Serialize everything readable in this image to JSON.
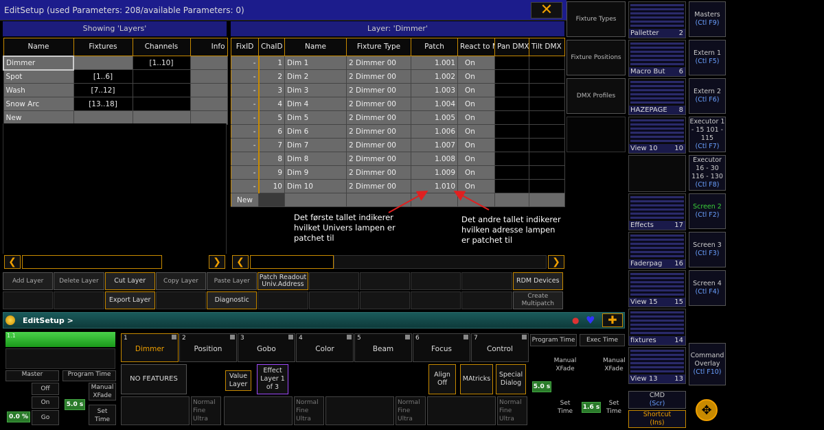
{
  "title": "EditSetup   (used Parameters: 208/available Parameters: 0)",
  "close_icon": "close-x",
  "left_panel": {
    "header": "Showing 'Layers'",
    "columns": [
      "Name",
      "Fixtures",
      "Channels",
      "Info"
    ],
    "rows": [
      {
        "name": "Dimmer",
        "fixtures": "",
        "channels": "[1..10]"
      },
      {
        "name": "Spot",
        "fixtures": "[1..6]",
        "channels": ""
      },
      {
        "name": "Wash",
        "fixtures": "[7..12]",
        "channels": ""
      },
      {
        "name": "Snow Arc",
        "fixtures": "[13..18]",
        "channels": ""
      },
      {
        "name": "New",
        "fixtures": "",
        "channels": ""
      }
    ]
  },
  "right_panel": {
    "header": "Layer: 'Dimmer'",
    "columns": [
      "FixID",
      "ChaID",
      "Name",
      "Fixture Type",
      "Patch",
      "React to Master",
      "Pan DMX Invert",
      "Tilt DMX Invert"
    ],
    "rows": [
      {
        "fixid": "-",
        "chaid": "1",
        "name": "Dim 1",
        "type": "2 Dimmer 00",
        "patch": "1.001",
        "react": "On"
      },
      {
        "fixid": "-",
        "chaid": "2",
        "name": "Dim 2",
        "type": "2 Dimmer 00",
        "patch": "1.002",
        "react": "On"
      },
      {
        "fixid": "-",
        "chaid": "3",
        "name": "Dim 3",
        "type": "2 Dimmer 00",
        "patch": "1.003",
        "react": "On"
      },
      {
        "fixid": "-",
        "chaid": "4",
        "name": "Dim 4",
        "type": "2 Dimmer 00",
        "patch": "1.004",
        "react": "On"
      },
      {
        "fixid": "-",
        "chaid": "5",
        "name": "Dim 5",
        "type": "2 Dimmer 00",
        "patch": "1.005",
        "react": "On"
      },
      {
        "fixid": "-",
        "chaid": "6",
        "name": "Dim 6",
        "type": "2 Dimmer 00",
        "patch": "1.006",
        "react": "On"
      },
      {
        "fixid": "-",
        "chaid": "7",
        "name": "Dim 7",
        "type": "2 Dimmer 00",
        "patch": "1.007",
        "react": "On"
      },
      {
        "fixid": "-",
        "chaid": "8",
        "name": "Dim 8",
        "type": "2 Dimmer 00",
        "patch": "1.008",
        "react": "On"
      },
      {
        "fixid": "-",
        "chaid": "9",
        "name": "Dim 9",
        "type": "2 Dimmer 00",
        "patch": "1.009",
        "react": "On"
      },
      {
        "fixid": "-",
        "chaid": "10",
        "name": "Dim 10",
        "type": "2 Dimmer 00",
        "patch": "1.010",
        "react": "On"
      }
    ],
    "new_label": "New"
  },
  "annotations": {
    "left": "Det første tallet indikerer hvilket Univers lampen er patchet til",
    "right": "Det andre tallet indikerer hvilken adresse lampen er patchet til"
  },
  "buttons_row1": [
    "Add Layer",
    "Delete Layer",
    "Cut Layer",
    "Copy Layer",
    "Paste Layer",
    "Patch Readout Univ.Address",
    "",
    "",
    "",
    "",
    "RDM Devices"
  ],
  "buttons_row2": [
    "",
    "",
    "Export Layer",
    "",
    "Diagnostic",
    "",
    "",
    "",
    "",
    "",
    "Create Multipatch"
  ],
  "side_buttons": [
    "Fixture Types",
    "Fixture Positions",
    "DMX Profiles"
  ],
  "views": [
    {
      "label": "Palletter",
      "num": "2"
    },
    {
      "label": "Macro But",
      "num": "6"
    },
    {
      "label": "HAZEPAGE",
      "num": "8"
    },
    {
      "label": "View 10",
      "num": "10"
    },
    {
      "label": "",
      "num": ""
    },
    {
      "label": "Effects",
      "num": "17"
    },
    {
      "label": "Faderpag",
      "num": "16"
    },
    {
      "label": "View 15",
      "num": "15"
    },
    {
      "label": "fixtures",
      "num": "14"
    },
    {
      "label": "View 13",
      "num": "13"
    }
  ],
  "screen_keys": [
    {
      "title": "Masters",
      "key": "(Ctl F9)"
    },
    {
      "title": "Extern 1",
      "key": "(Ctl F5)"
    },
    {
      "title": "Extern 2",
      "key": "(Ctl F6)"
    },
    {
      "title": "Executor 1 - 15 101 - 115",
      "key": "(Ctl F7)"
    },
    {
      "title": "Executor 16 - 30 116 - 130",
      "key": "(Ctl F8)"
    },
    {
      "title": "Screen 2",
      "key": "(Ctl F2)"
    },
    {
      "title": "Screen 3",
      "key": "(Ctl F3)"
    },
    {
      "title": "Screen 4",
      "key": "(Ctl F4)"
    },
    {
      "title": "Command Overlay",
      "key": "(Ctl F10)"
    }
  ],
  "cmd": {
    "title": "CMD",
    "key": "(Scr)"
  },
  "shortcut": {
    "title": "Shortcut",
    "key": "(Ins)"
  },
  "command_line": "EditSetup >",
  "preset_tabs": [
    {
      "num": "1",
      "label": "Dimmer"
    },
    {
      "num": "2",
      "label": "Position"
    },
    {
      "num": "3",
      "label": "Gobo"
    },
    {
      "num": "4",
      "label": "Color"
    },
    {
      "num": "5",
      "label": "Beam"
    },
    {
      "num": "6",
      "label": "Focus"
    },
    {
      "num": "7",
      "label": "Control"
    }
  ],
  "bottom": {
    "exec_label": "1.1",
    "master": "Master",
    "off": "Off",
    "on": "On",
    "go": "Go",
    "master_value": "0.0 %",
    "program_time": "Program Time",
    "manual_xfade": "Manual XFade",
    "set_time": "Set Time",
    "time_value": "5.0 s",
    "no_features": "NO FEATURES",
    "value_layer": "Value Layer",
    "effect_layer": "Effect Layer 1 of 3",
    "align_off": "Align Off",
    "matricks": "MAtricks",
    "special_dialog": "Special Dialog",
    "normal": "Normal",
    "fine": "Fine",
    "ultra": "Ultra",
    "exec_time": "Exec Time",
    "exec_value": "1.6 s"
  }
}
